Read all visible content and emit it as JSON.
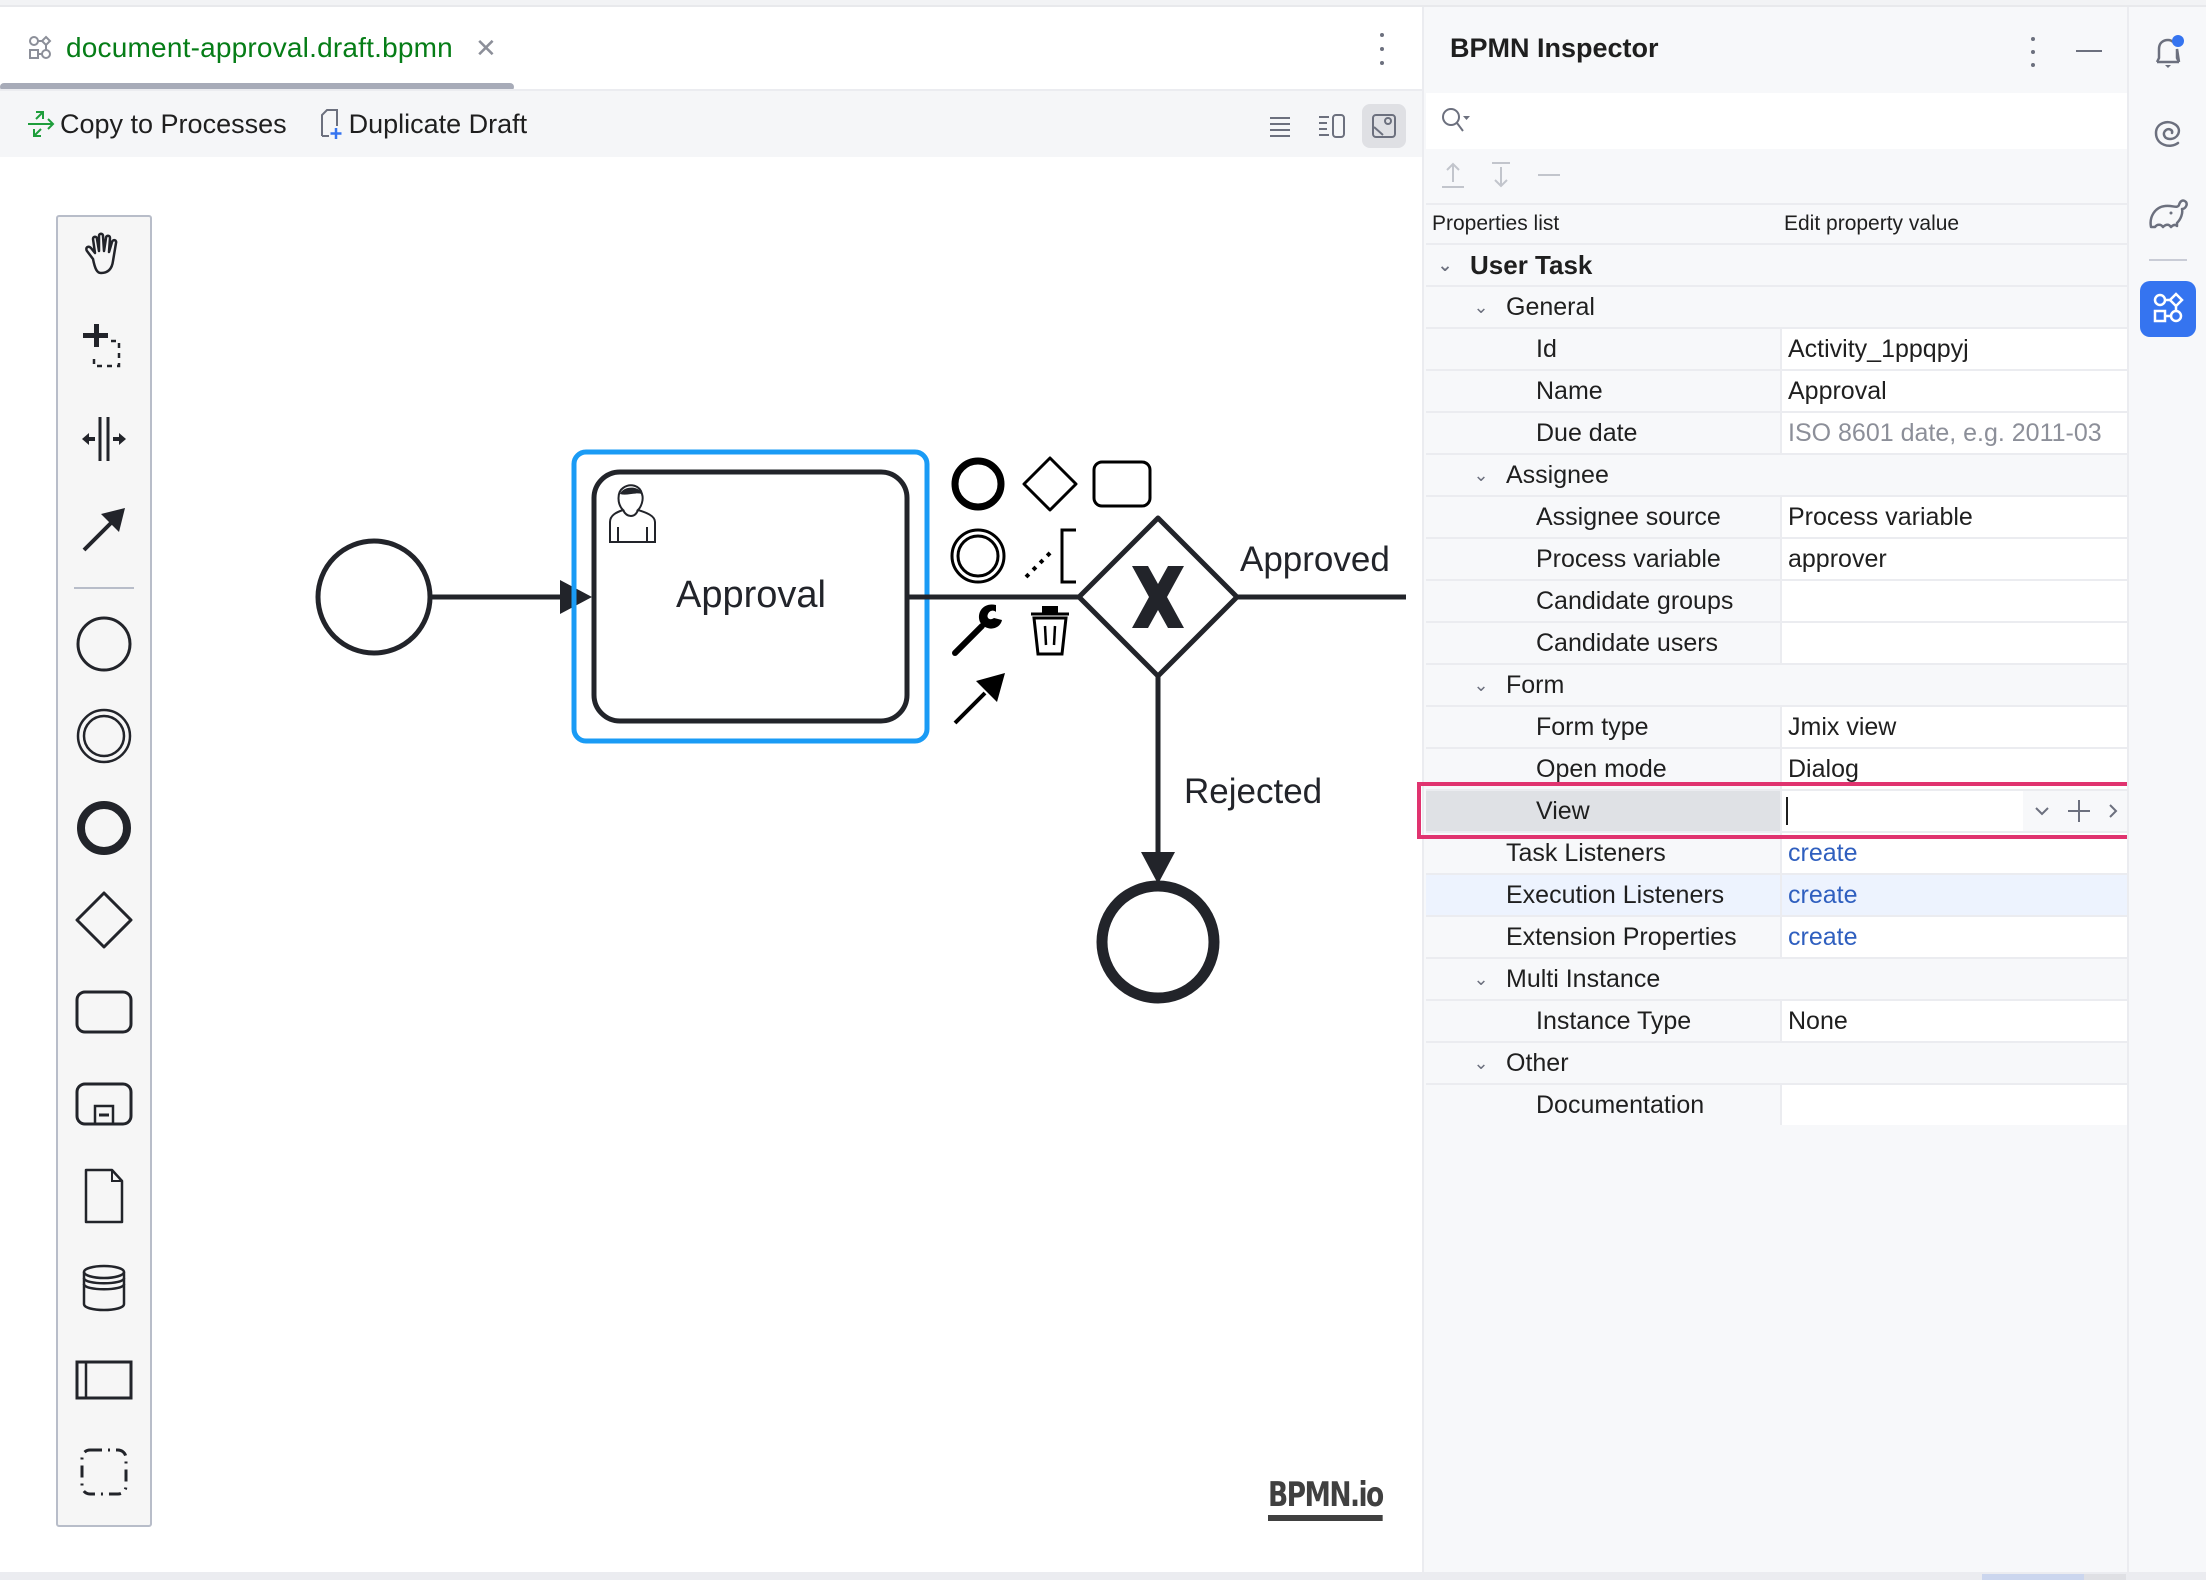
{
  "editor": {
    "tab": {
      "title": "document-approval.draft.bpmn",
      "icon": "bpmn-diagram-icon",
      "close_icon": "close-icon",
      "title_color": "#067d17"
    },
    "toolbar": {
      "copy_to_processes_label": "Copy to Processes",
      "duplicate_draft_label": "Duplicate Draft",
      "view_modes": [
        "text-view-icon",
        "split-view-icon",
        "diagram-view-icon"
      ],
      "active_view_mode": "diagram-view-icon"
    },
    "palette": {
      "tools": [
        "hand-tool",
        "lasso-tool",
        "space-tool",
        "global-connect-tool"
      ],
      "elements": [
        "start-event",
        "intermediate-event",
        "end-event",
        "gateway",
        "task",
        "subprocess",
        "data-object",
        "data-store",
        "pool",
        "group"
      ]
    },
    "diagram": {
      "task": {
        "name": "Approval",
        "type": "User Task",
        "selected": true
      },
      "gateway": {
        "type": "exclusive",
        "marker": "X"
      },
      "flows": {
        "approved_label": "Approved",
        "rejected_label": "Rejected"
      },
      "context_pad": [
        "append-end-event",
        "append-gateway",
        "append-task",
        "append-intermediate-event",
        "append-text-annotation",
        "change-type",
        "delete",
        "connect"
      ],
      "selection_color": "#1a9bf5",
      "logo": "BPMN.io"
    }
  },
  "inspector": {
    "title": "BPMN Inspector",
    "search_placeholder": "",
    "header": {
      "col1": "Properties list",
      "col2": "Edit property value"
    },
    "rows": [
      {
        "level": 0,
        "group": true,
        "name": "User Task"
      },
      {
        "level": 1,
        "group": true,
        "name": "General"
      },
      {
        "level": 2,
        "name": "Id",
        "value": "Activity_1ppqpyj"
      },
      {
        "level": 2,
        "name": "Name",
        "value": "Approval"
      },
      {
        "level": 2,
        "name": "Due date",
        "value": "ISO 8601 date, e.g. 2011-03",
        "placeholder": true
      },
      {
        "level": 1,
        "group": true,
        "name": "Assignee"
      },
      {
        "level": 2,
        "name": "Assignee source",
        "value": "Process variable"
      },
      {
        "level": 2,
        "name": "Process variable",
        "value": "approver"
      },
      {
        "level": 2,
        "name": "Candidate groups",
        "value": ""
      },
      {
        "level": 2,
        "name": "Candidate users",
        "value": ""
      },
      {
        "level": 1,
        "group": true,
        "name": "Form"
      },
      {
        "level": 2,
        "name": "Form type",
        "value": "Jmix view"
      },
      {
        "level": 2,
        "name": "Open mode",
        "value": "Dialog"
      },
      {
        "level": 2,
        "name": "View",
        "value": "",
        "editing": true
      },
      {
        "level": 1,
        "name": "Task Listeners",
        "value": "create",
        "link": true
      },
      {
        "level": 1,
        "name": "Execution Listeners",
        "value": "create",
        "link": true,
        "hover": true
      },
      {
        "level": 1,
        "name": "Extension Properties",
        "value": "create",
        "link": true
      },
      {
        "level": 1,
        "group": true,
        "name": "Multi Instance"
      },
      {
        "level": 2,
        "name": "Instance Type",
        "value": "None"
      },
      {
        "level": 1,
        "group": true,
        "name": "Other"
      },
      {
        "level": 2,
        "name": "Documentation",
        "value": ""
      }
    ],
    "highlight_color": "#e0336f",
    "link_color": "#2f5fbf"
  },
  "right_strip": {
    "buttons": [
      "notifications-icon",
      "ai-assistant-icon",
      "gradle-icon",
      "bpmn-inspector-icon"
    ],
    "active": "bpmn-inspector-icon",
    "notification_badge": true,
    "accent": "#3574f0"
  }
}
